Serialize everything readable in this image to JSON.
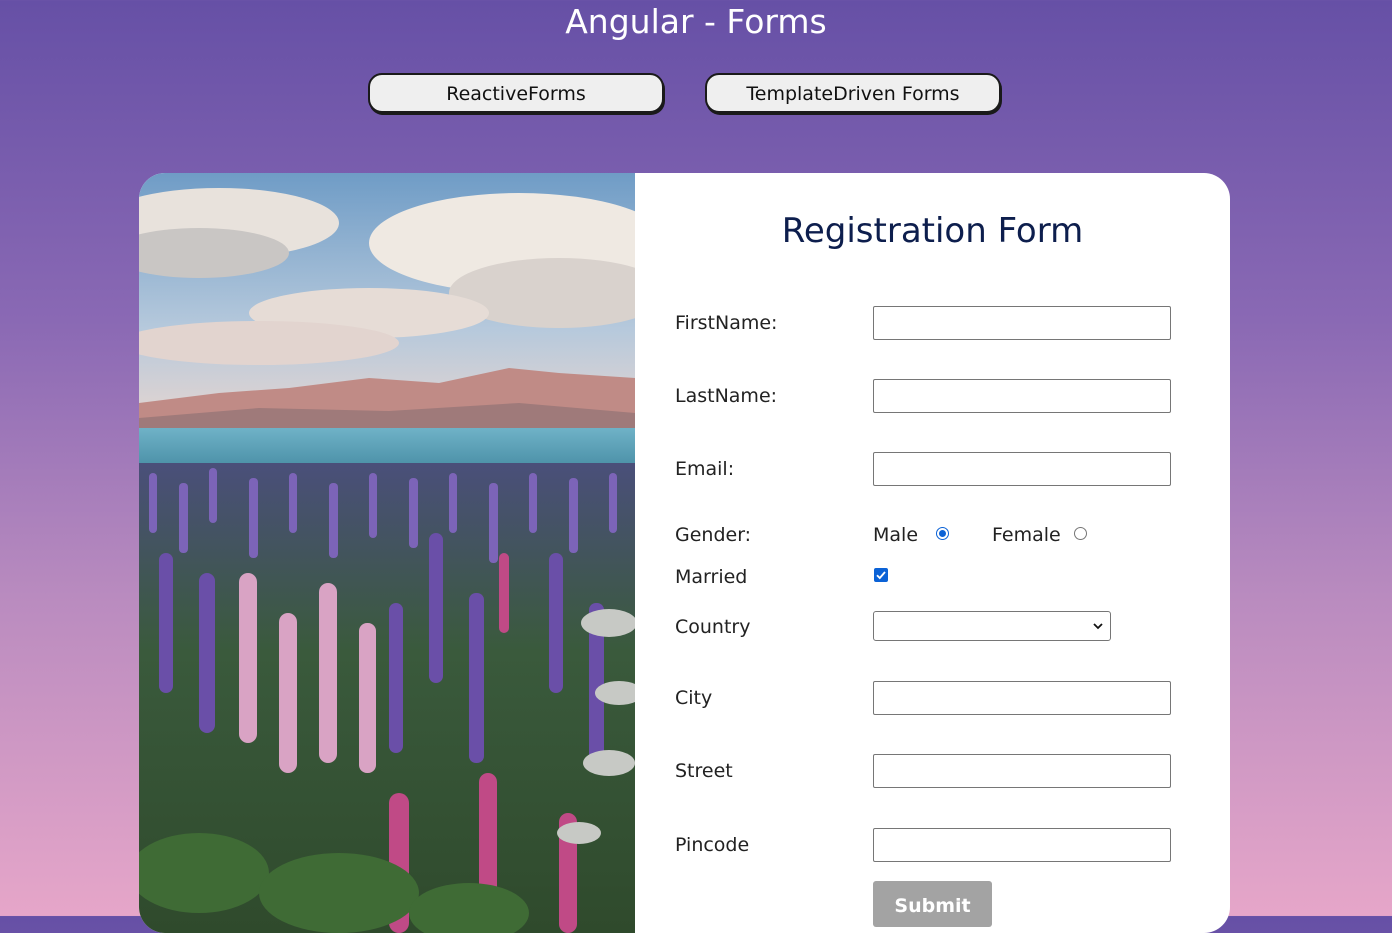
{
  "header": {
    "title": "Angular - Forms"
  },
  "nav": {
    "reactive_label": "ReactiveForms",
    "template_label": "TemplateDriven Forms"
  },
  "form": {
    "title": "Registration Form",
    "first_name_label": "FirstName:",
    "last_name_label": "LastName:",
    "email_label": "Email:",
    "gender_label": "Gender:",
    "gender_options": [
      {
        "label": "Male",
        "selected": true
      },
      {
        "label": "Female",
        "selected": false
      }
    ],
    "married_label": "Married",
    "married_checked": true,
    "country_label": "Country",
    "country_value": "",
    "city_label": "City",
    "street_label": "Street",
    "pincode_label": "Pincode",
    "first_name_value": "",
    "last_name_value": "",
    "email_value": "",
    "city_value": "",
    "street_value": "",
    "pincode_value": "",
    "submit_label": "Submit"
  },
  "colors": {
    "accent": "#0b62d6",
    "title": "#0d1e4d",
    "submit_bg": "#a3a3a3"
  },
  "icons": [
    "chevron-down-icon",
    "checkmark-icon"
  ]
}
